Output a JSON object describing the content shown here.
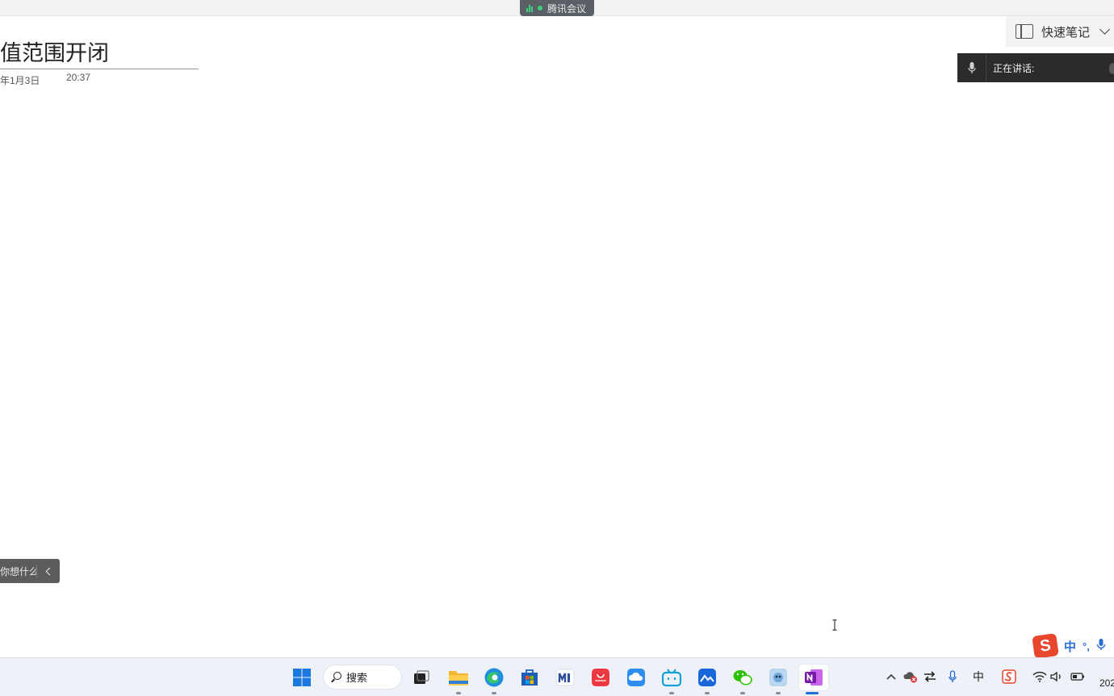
{
  "meeting": {
    "label": "腾讯会议"
  },
  "quick_notes": {
    "label": "快速笔记"
  },
  "speaking": {
    "label": "正在讲话:"
  },
  "note": {
    "title": "值范围开闭",
    "date": "年1月3日",
    "time": "20:37"
  },
  "assistant": {
    "prompt": "你想什么..."
  },
  "ime": {
    "mode": "中",
    "punct": "°,"
  },
  "taskbar": {
    "search_label": "搜索",
    "apps": [
      {
        "name": "start-icon"
      },
      {
        "name": "task-view-icon"
      },
      {
        "name": "file-explorer-icon"
      },
      {
        "name": "edge-icon"
      },
      {
        "name": "store-icon"
      },
      {
        "name": "mail-icon"
      },
      {
        "name": "huawei-appgallery-icon"
      },
      {
        "name": "cloud-icon"
      },
      {
        "name": "bilibili-icon"
      },
      {
        "name": "lanhu-icon"
      },
      {
        "name": "wechat-icon"
      },
      {
        "name": "game-app-icon"
      },
      {
        "name": "onenote-icon"
      }
    ],
    "tray": {
      "ime_indicator": "中",
      "clock": "202"
    }
  },
  "colors": {
    "accent": "#1f6fd6",
    "meeting_green": "#3ed07a",
    "ime_red": "#e8462d",
    "onenote_purple": "#7719aa"
  }
}
